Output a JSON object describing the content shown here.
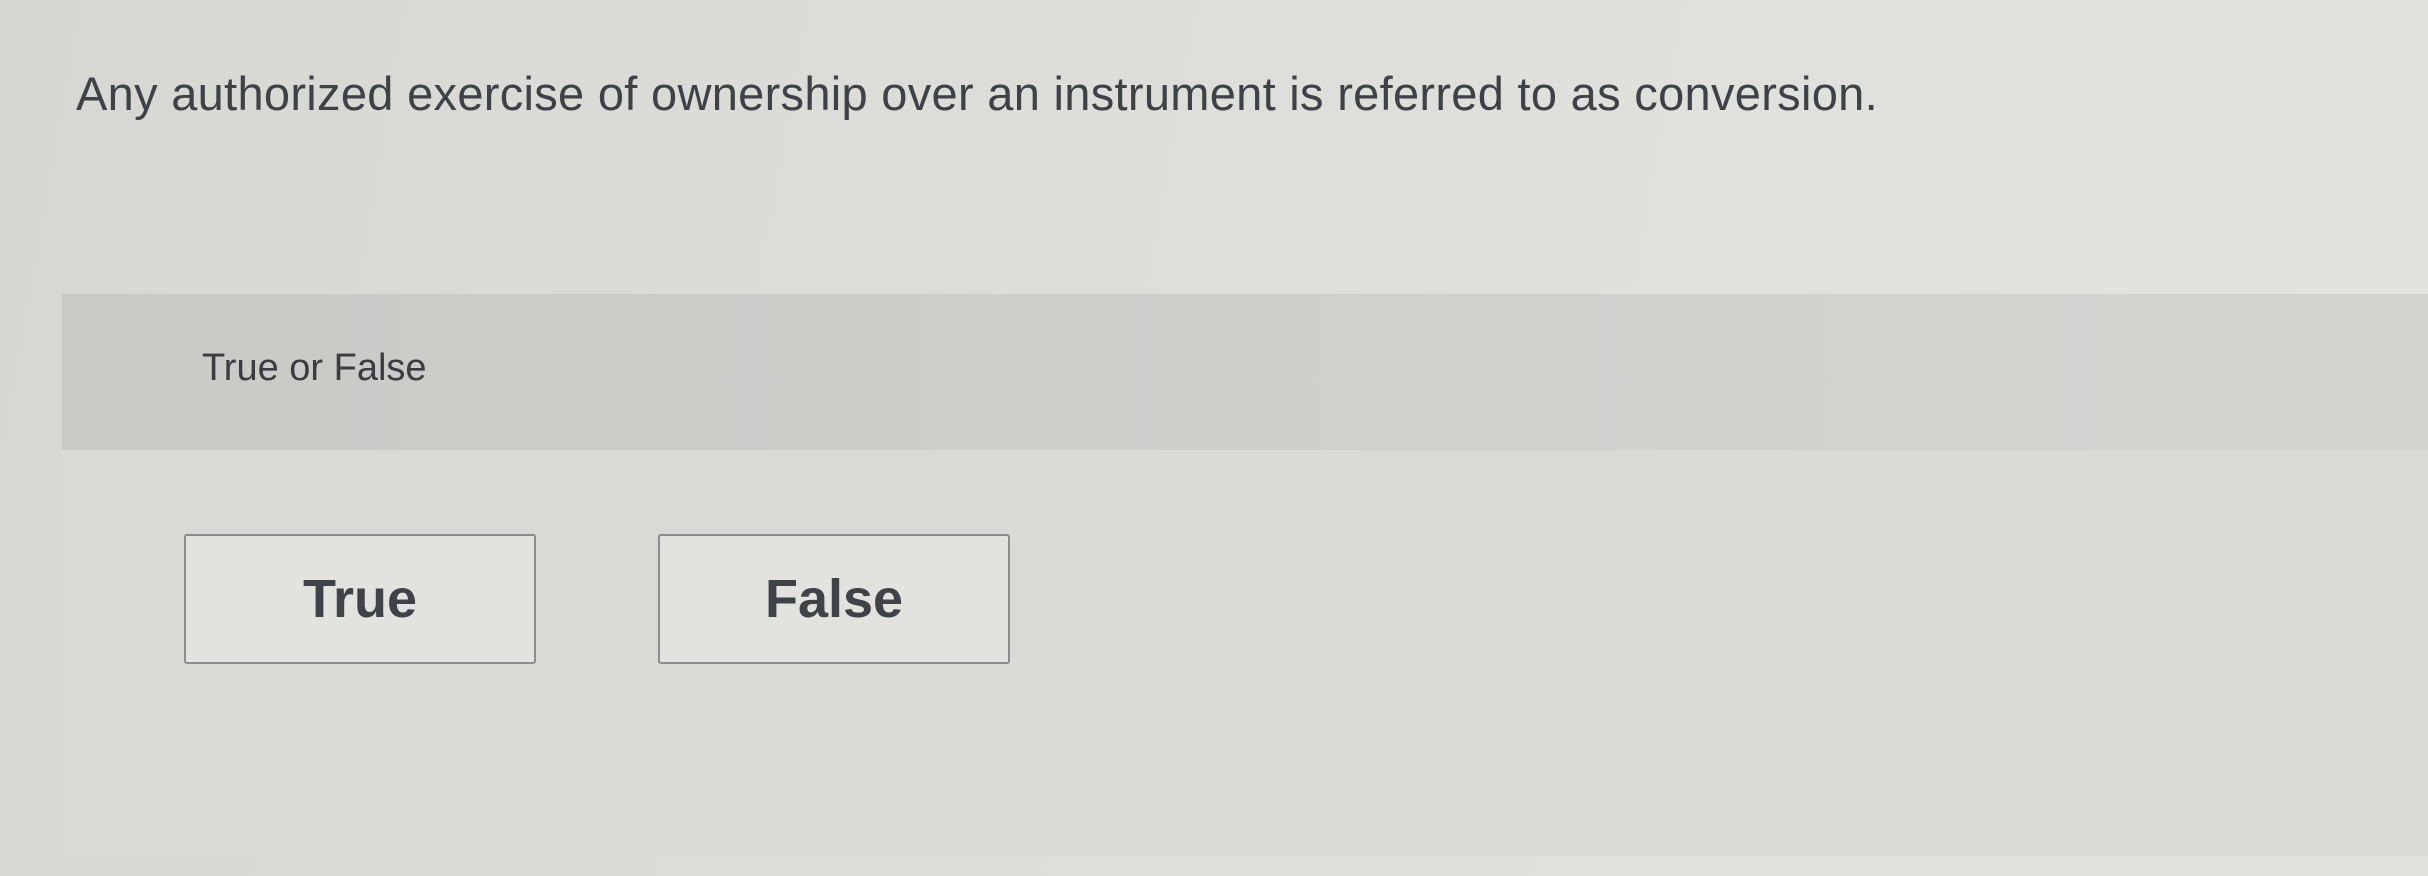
{
  "question": {
    "text": "Any authorized exercise of ownership over an instrument is referred to as conversion."
  },
  "answer_panel": {
    "label": "True or False",
    "options": [
      {
        "label": "True"
      },
      {
        "label": "False"
      }
    ]
  }
}
